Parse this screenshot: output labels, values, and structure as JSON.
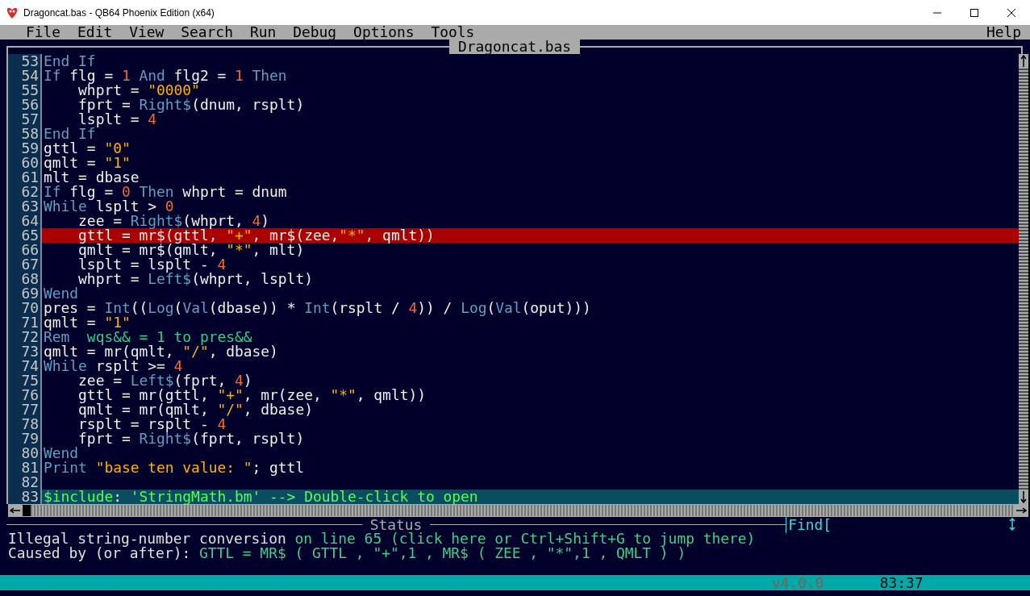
{
  "window": {
    "title": "Dragoncat.bas - QB64 Phoenix Edition (x64)"
  },
  "menu": {
    "items": [
      "File",
      "Edit",
      "View",
      "Search",
      "Run",
      "Debug",
      "Options",
      "Tools"
    ],
    "help": "Help"
  },
  "editor": {
    "tab": "Dragoncat.bas",
    "lines": [
      {
        "number": "53",
        "error": false,
        "current": false,
        "tokens": [
          {
            "kind": "keyword",
            "text": "End If"
          }
        ]
      },
      {
        "number": "54",
        "error": false,
        "current": false,
        "tokens": [
          {
            "kind": "keyword",
            "text": "If"
          },
          {
            "kind": "plain",
            "text": " flg = "
          },
          {
            "kind": "number",
            "text": "1"
          },
          {
            "kind": "keyword",
            "text": " And"
          },
          {
            "kind": "plain",
            "text": " flg2 = "
          },
          {
            "kind": "number",
            "text": "1"
          },
          {
            "kind": "keyword",
            "text": " Then"
          }
        ]
      },
      {
        "number": "55",
        "error": false,
        "current": false,
        "tokens": [
          {
            "kind": "plain",
            "text": "    whprt = "
          },
          {
            "kind": "string",
            "text": "\"0000\""
          }
        ]
      },
      {
        "number": "56",
        "error": false,
        "current": false,
        "tokens": [
          {
            "kind": "plain",
            "text": "    fprt = "
          },
          {
            "kind": "keyword",
            "text": "Right$"
          },
          {
            "kind": "plain",
            "text": "(dnum, rsplt)"
          }
        ]
      },
      {
        "number": "57",
        "error": false,
        "current": false,
        "tokens": [
          {
            "kind": "plain",
            "text": "    lsplt = "
          },
          {
            "kind": "number",
            "text": "4"
          }
        ]
      },
      {
        "number": "58",
        "error": false,
        "current": false,
        "tokens": [
          {
            "kind": "keyword",
            "text": "End If"
          }
        ]
      },
      {
        "number": "59",
        "error": false,
        "current": false,
        "tokens": [
          {
            "kind": "plain",
            "text": "gttl = "
          },
          {
            "kind": "string",
            "text": "\"0\""
          }
        ]
      },
      {
        "number": "60",
        "error": false,
        "current": false,
        "tokens": [
          {
            "kind": "plain",
            "text": "qmlt = "
          },
          {
            "kind": "string",
            "text": "\"1\""
          }
        ]
      },
      {
        "number": "61",
        "error": false,
        "current": false,
        "tokens": [
          {
            "kind": "plain",
            "text": "mlt = dbase"
          }
        ]
      },
      {
        "number": "62",
        "error": false,
        "current": false,
        "tokens": [
          {
            "kind": "keyword",
            "text": "If"
          },
          {
            "kind": "plain",
            "text": " flg = "
          },
          {
            "kind": "number",
            "text": "0"
          },
          {
            "kind": "keyword",
            "text": " Then"
          },
          {
            "kind": "plain",
            "text": " whprt = dnum"
          }
        ]
      },
      {
        "number": "63",
        "error": false,
        "current": false,
        "tokens": [
          {
            "kind": "keyword",
            "text": "While"
          },
          {
            "kind": "plain",
            "text": " lsplt > "
          },
          {
            "kind": "number",
            "text": "0"
          }
        ]
      },
      {
        "number": "64",
        "error": false,
        "current": false,
        "tokens": [
          {
            "kind": "plain",
            "text": "    zee = "
          },
          {
            "kind": "keyword",
            "text": "Right$"
          },
          {
            "kind": "plain",
            "text": "(whprt, "
          },
          {
            "kind": "number",
            "text": "4"
          },
          {
            "kind": "plain",
            "text": ")"
          }
        ]
      },
      {
        "number": "65",
        "error": true,
        "current": false,
        "tokens": [
          {
            "kind": "plain",
            "text": "    gttl = mr$(gttl, "
          },
          {
            "kind": "string",
            "text": "\"+\""
          },
          {
            "kind": "plain",
            "text": ", mr$(zee,"
          },
          {
            "kind": "string",
            "text": "\"*\""
          },
          {
            "kind": "plain",
            "text": ", qmlt))"
          }
        ]
      },
      {
        "number": "66",
        "error": false,
        "current": false,
        "tokens": [
          {
            "kind": "plain",
            "text": "    qmlt = mr$(qmlt, "
          },
          {
            "kind": "string",
            "text": "\"*\""
          },
          {
            "kind": "plain",
            "text": ", mlt)"
          }
        ]
      },
      {
        "number": "67",
        "error": false,
        "current": false,
        "tokens": [
          {
            "kind": "plain",
            "text": "    lsplt = lsplt - "
          },
          {
            "kind": "number",
            "text": "4"
          }
        ]
      },
      {
        "number": "68",
        "error": false,
        "current": false,
        "tokens": [
          {
            "kind": "plain",
            "text": "    whprt = "
          },
          {
            "kind": "keyword",
            "text": "Left$"
          },
          {
            "kind": "plain",
            "text": "(whprt, lsplt)"
          }
        ]
      },
      {
        "number": "69",
        "error": false,
        "current": false,
        "tokens": [
          {
            "kind": "keyword",
            "text": "Wend"
          }
        ]
      },
      {
        "number": "70",
        "error": false,
        "current": false,
        "tokens": [
          {
            "kind": "plain",
            "text": "pres = "
          },
          {
            "kind": "keyword",
            "text": "Int"
          },
          {
            "kind": "plain",
            "text": "(("
          },
          {
            "kind": "keyword",
            "text": "Log"
          },
          {
            "kind": "plain",
            "text": "("
          },
          {
            "kind": "keyword",
            "text": "Val"
          },
          {
            "kind": "plain",
            "text": "(dbase)) * "
          },
          {
            "kind": "keyword",
            "text": "Int"
          },
          {
            "kind": "plain",
            "text": "(rsplt / "
          },
          {
            "kind": "number",
            "text": "4"
          },
          {
            "kind": "plain",
            "text": ")) / "
          },
          {
            "kind": "keyword",
            "text": "Log"
          },
          {
            "kind": "plain",
            "text": "("
          },
          {
            "kind": "keyword",
            "text": "Val"
          },
          {
            "kind": "plain",
            "text": "(oput)))"
          }
        ]
      },
      {
        "number": "71",
        "error": false,
        "current": false,
        "tokens": [
          {
            "kind": "plain",
            "text": "qmlt = "
          },
          {
            "kind": "string",
            "text": "\"1\""
          }
        ]
      },
      {
        "number": "72",
        "error": false,
        "current": false,
        "tokens": [
          {
            "kind": "keyword",
            "text": "Rem"
          },
          {
            "kind": "comment",
            "text": "  wqs&& = 1 to pres&&"
          }
        ]
      },
      {
        "number": "73",
        "error": false,
        "current": false,
        "tokens": [
          {
            "kind": "plain",
            "text": "qmlt = mr(qmlt, "
          },
          {
            "kind": "string",
            "text": "\"/\""
          },
          {
            "kind": "plain",
            "text": ", dbase)"
          }
        ]
      },
      {
        "number": "74",
        "error": false,
        "current": false,
        "tokens": [
          {
            "kind": "keyword",
            "text": "While"
          },
          {
            "kind": "plain",
            "text": " rsplt >= "
          },
          {
            "kind": "number",
            "text": "4"
          }
        ]
      },
      {
        "number": "75",
        "error": false,
        "current": false,
        "tokens": [
          {
            "kind": "plain",
            "text": "    zee = "
          },
          {
            "kind": "keyword",
            "text": "Left$"
          },
          {
            "kind": "plain",
            "text": "(fprt, "
          },
          {
            "kind": "number",
            "text": "4"
          },
          {
            "kind": "plain",
            "text": ")"
          }
        ]
      },
      {
        "number": "76",
        "error": false,
        "current": false,
        "tokens": [
          {
            "kind": "plain",
            "text": "    gttl = mr(gttl, "
          },
          {
            "kind": "string",
            "text": "\"+\""
          },
          {
            "kind": "plain",
            "text": ", mr(zee, "
          },
          {
            "kind": "string",
            "text": "\"*\""
          },
          {
            "kind": "plain",
            "text": ", qmlt))"
          }
        ]
      },
      {
        "number": "77",
        "error": false,
        "current": false,
        "tokens": [
          {
            "kind": "plain",
            "text": "    qmlt = mr(qmlt, "
          },
          {
            "kind": "string",
            "text": "\"/\""
          },
          {
            "kind": "plain",
            "text": ", dbase)"
          }
        ]
      },
      {
        "number": "78",
        "error": false,
        "current": false,
        "tokens": [
          {
            "kind": "plain",
            "text": "    rsplt = rsplt - "
          },
          {
            "kind": "number",
            "text": "4"
          }
        ]
      },
      {
        "number": "79",
        "error": false,
        "current": false,
        "tokens": [
          {
            "kind": "plain",
            "text": "    fprt = "
          },
          {
            "kind": "keyword",
            "text": "Right$"
          },
          {
            "kind": "plain",
            "text": "(fprt, rsplt)"
          }
        ]
      },
      {
        "number": "80",
        "error": false,
        "current": false,
        "tokens": [
          {
            "kind": "keyword",
            "text": "Wend"
          }
        ]
      },
      {
        "number": "81",
        "error": false,
        "current": false,
        "tokens": [
          {
            "kind": "keyword",
            "text": "Print"
          },
          {
            "kind": "string",
            "text": " \"base ten value: \""
          },
          {
            "kind": "plain",
            "text": "; gttl"
          }
        ]
      },
      {
        "number": "82",
        "error": false,
        "current": false
      },
      {
        "number": "83",
        "error": false,
        "current": true,
        "tokens": [
          {
            "kind": "meta",
            "text": "$include"
          },
          {
            "kind": "plain",
            "text": ": "
          },
          {
            "kind": "meta",
            "text": "'StringMath.bm' --> Double-click to open"
          }
        ]
      }
    ]
  },
  "status": {
    "title": "Status",
    "find": "Find[",
    "messages": [
      {
        "parts": [
          {
            "kind": "plain",
            "text": "Illegal string-number conversion "
          },
          {
            "kind": "link",
            "text": "on line 65 (click here or Ctrl+Shift+G to jump there)"
          }
        ]
      },
      {
        "parts": [
          {
            "kind": "plain",
            "text": "Caused by (or after): "
          },
          {
            "kind": "code",
            "text": "GTTL = MR$ ( GTTL , \"+\",1 , MR$ ( ZEE , \"*\",1 , QMLT ) )"
          }
        ]
      }
    ]
  },
  "status_bar": {
    "version": "v4.0.0",
    "position": "83:37"
  }
}
